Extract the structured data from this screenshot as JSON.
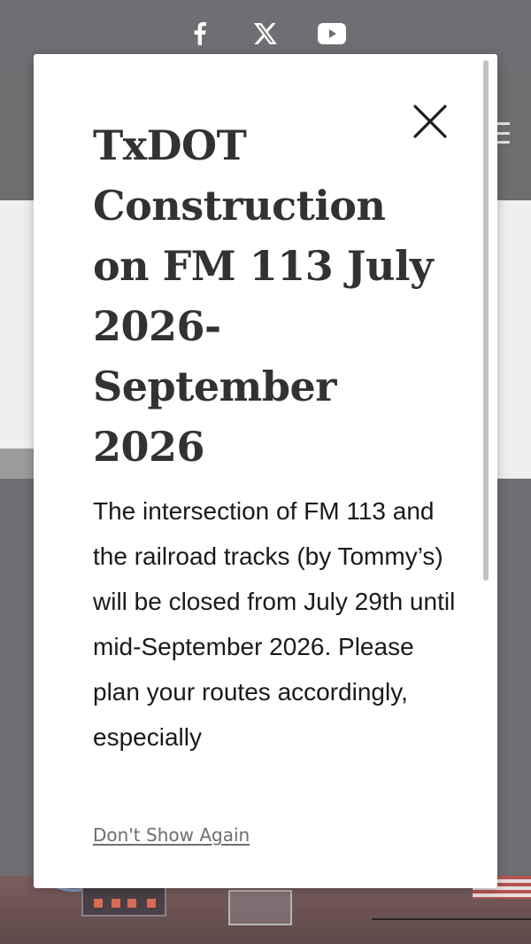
{
  "social": {
    "icons": [
      "facebook-icon",
      "x-twitter-icon",
      "youtube-icon"
    ]
  },
  "modal": {
    "title": "TxDOT Construction on FM 113 July 2026-September 2026",
    "body": "The intersection of FM 113 and the railroad tracks (by Tommy’s) will be closed from July 29th until mid-September 2026. Please plan your routes accordingly, especially",
    "dont_show_again": "Don't Show Again",
    "close_icon": "close-icon"
  },
  "colors": {
    "backdrop": "#6f6e72",
    "modal_bg": "#ffffff",
    "title_text": "#323232",
    "body_text": "#1a1a1a",
    "link_text": "#6e6e6e"
  }
}
